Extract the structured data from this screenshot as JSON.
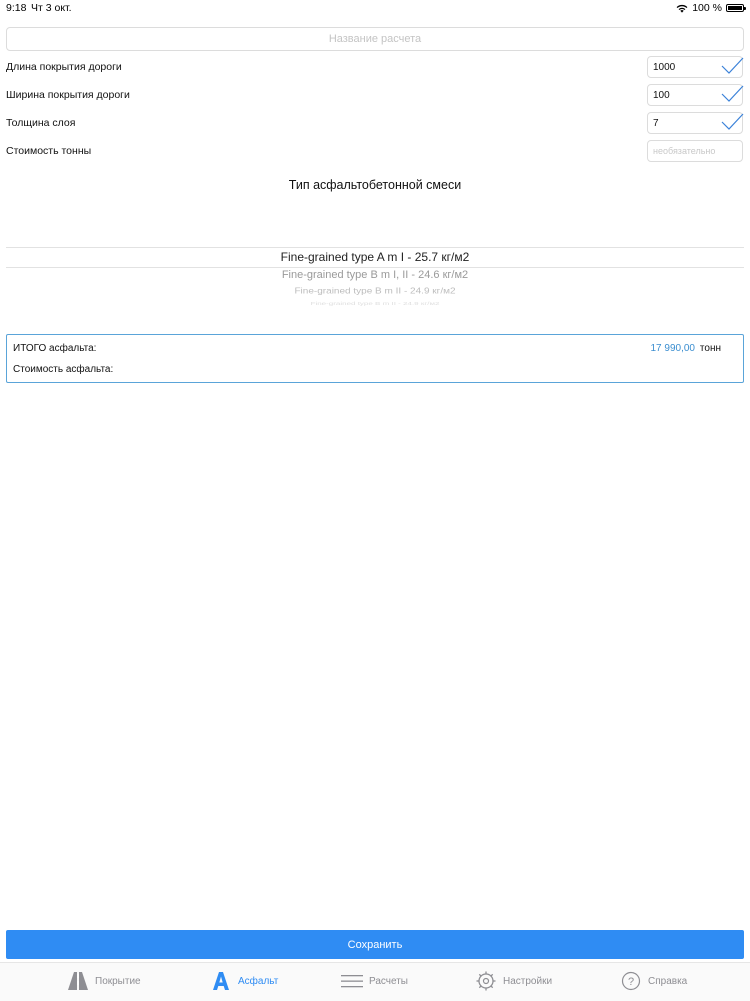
{
  "status_bar": {
    "time": "9:18",
    "date": "Чт 3 окт.",
    "battery": "100 %",
    "battery_level": 1.0
  },
  "form": {
    "title_placeholder": "Название расчета",
    "rows": [
      {
        "label": "Длина покрытия дороги",
        "value": "1000",
        "checked": true
      },
      {
        "label": "Ширина покрытия дороги",
        "value": "100",
        "checked": true
      },
      {
        "label": "Толщина слоя",
        "value": "7",
        "checked": true
      },
      {
        "label": "Стоимость тонны",
        "value": "",
        "placeholder": "необязательно",
        "checked": false
      }
    ]
  },
  "mix": {
    "title": "Тип асфальтобетонной смеси",
    "options": [
      "Fine-grained type A m I - 25.7 кг/м2",
      "Fine-grained type B m I, II - 24.6 кг/м2",
      "Fine-grained type B m II - 24.9 кг/м2",
      "Fine-grained type B m II - 24.9 кг/м2"
    ]
  },
  "result": {
    "total_label": "ИТОГО асфальта:",
    "total_value": "17 990,00",
    "total_unit": "тонн",
    "cost_label": "Стоимость асфальта:"
  },
  "save_label": "Сохранить",
  "colors": {
    "accent": "#2f8cf3",
    "value_blue": "#3b8ed0",
    "check": "#3b82d9",
    "inactive": "#8e8e93"
  },
  "tabs": [
    {
      "label": "Покрытие",
      "icon": "road-icon",
      "active": false
    },
    {
      "label": "Асфальт",
      "icon": "asphalt-a-icon",
      "active": true
    },
    {
      "label": "Расчеты",
      "icon": "list-icon",
      "active": false
    },
    {
      "label": "Настройки",
      "icon": "gear-icon",
      "active": false
    },
    {
      "label": "Справка",
      "icon": "help-icon",
      "active": false
    }
  ]
}
